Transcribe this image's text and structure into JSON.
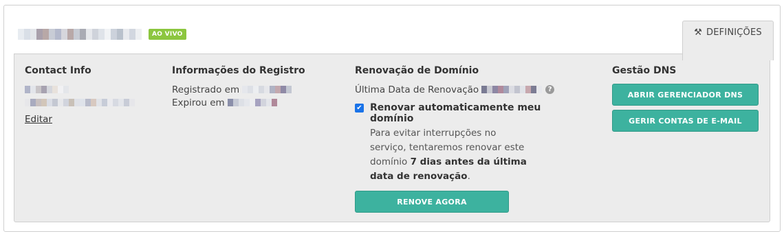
{
  "domain": {
    "name_redacted": true,
    "status_badge": "AO VIVO"
  },
  "tab": {
    "label": "DEFINIÇÕES",
    "icon": "tools-icon"
  },
  "contact": {
    "heading": "Contact Info",
    "edit_label": "Editar"
  },
  "registry": {
    "heading": "Informações do Registro",
    "registered_label": "Registrado em",
    "expired_label": "Expirou em"
  },
  "renewal": {
    "heading": "Renovação de Domínio",
    "last_renewal_label": "Última Data de Renovação",
    "auto_renew_label": "Renovar automaticamente meu domínio",
    "auto_renew_checked": true,
    "note_prefix": "Para evitar interrupções no serviço, tentaremos renovar este domínio ",
    "note_bold": "7 dias antes da última data de renovação",
    "note_suffix": ".",
    "renew_button": "RENOVE AGORA"
  },
  "dns": {
    "heading": "Gestão DNS",
    "open_dns_button": "ABRIR GERENCIADOR DNS",
    "email_button": "GERIR CONTAS DE E-MAIL"
  },
  "colors": {
    "accent": "#3db29f",
    "badge": "#8cc63f",
    "checkbox": "#1a73e8"
  }
}
